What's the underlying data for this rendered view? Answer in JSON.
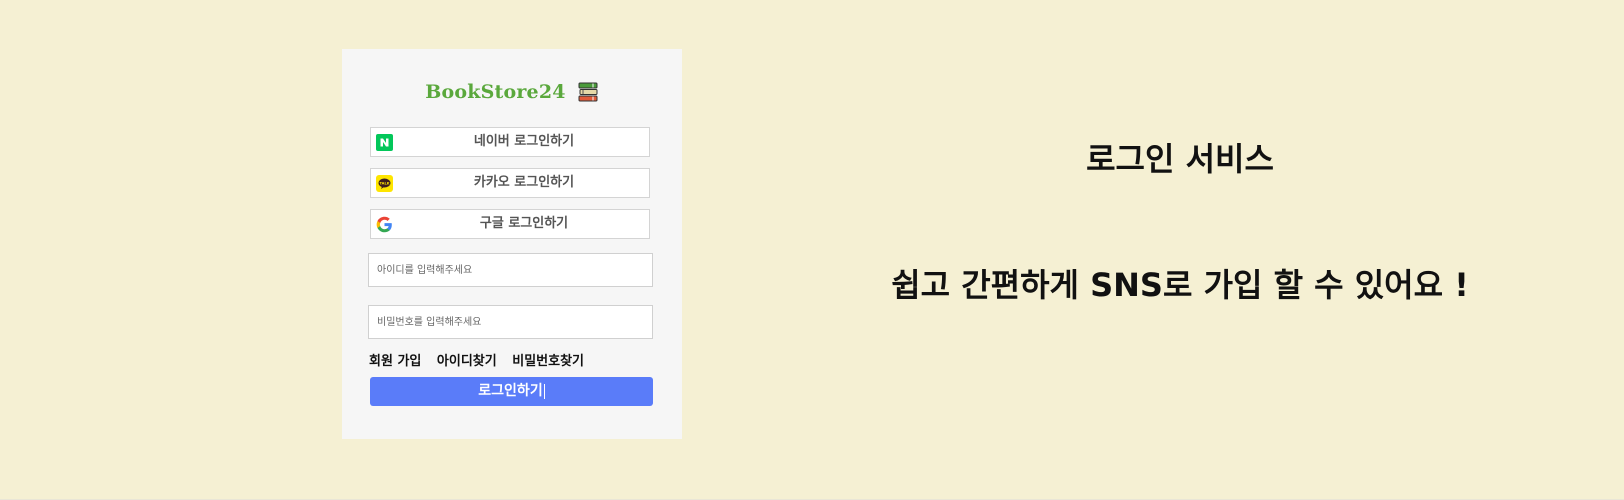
{
  "brand": {
    "name": "BookStore24",
    "color": "#5aa83c"
  },
  "social_login": {
    "naver": {
      "label": "네이버 로그인하기",
      "color": "#03c75a",
      "icon": "naver-icon"
    },
    "kakao": {
      "label": "카카오 로그인하기",
      "color": "#fee500",
      "icon": "kakao-icon"
    },
    "google": {
      "label": "구글 로그인하기",
      "icon": "google-icon"
    }
  },
  "form": {
    "id_placeholder": "아이디를 입력해주세요",
    "password_placeholder": "비밀번호를 입력해주세요"
  },
  "links": {
    "signup": "회원 가입",
    "find_id": "아이디찾기",
    "find_password": "비밀번호찾기"
  },
  "login_button": {
    "label": "로그인하기",
    "color": "#5a7cf9"
  },
  "promo": {
    "title": "로그인 서비스",
    "subtitle": "쉽고 간편하게 SNS로 가입 할 수 있어요 !"
  },
  "colors": {
    "background": "#f5f0d3",
    "card": "#f6f6f6"
  }
}
